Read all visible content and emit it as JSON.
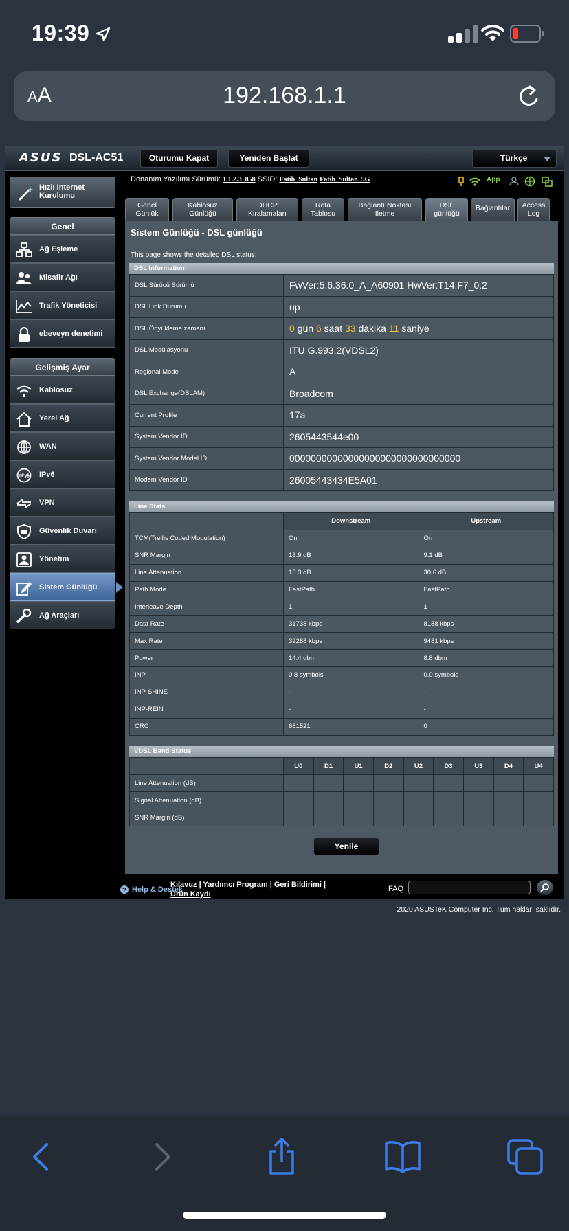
{
  "status_bar": {
    "time": "19:39"
  },
  "browser": {
    "aa_small": "A",
    "aa_large": "A",
    "url": "192.168.1.1"
  },
  "router": {
    "logo": "ASUS",
    "model": "DSL-AC51",
    "buttons": {
      "logout": "Oturumu Kapat",
      "reboot": "Yeniden Başlat"
    },
    "language": "Türkçe",
    "fw_label": "Donanım Yazılımı Sürümü:",
    "fw_version": "1.1.2.3_858",
    "ssid_label": "SSID:",
    "ssid_1": "Fatih_Sultan",
    "ssid_2": "Fatih_Sultan_5G",
    "app_label": "App"
  },
  "sidebar": {
    "quick_setup": "Hızlı Internet Kurulumu",
    "general_header": "Genel",
    "general_items": [
      "Ağ Eşleme",
      "Misafir Ağı",
      "Trafik Yöneticisi",
      "ebeveyn denetimi"
    ],
    "advanced_header": "Gelişmiş Ayar",
    "advanced_items": [
      "Kablosuz",
      "Yerel Ağ",
      "WAN",
      "IPv6",
      "VPN",
      "Güvenlik Duvarı",
      "Yönetim",
      "Sistem Günlüğü",
      "Ağ Araçları"
    ]
  },
  "tabs": [
    {
      "l1": "Genel",
      "l2": "Günlük"
    },
    {
      "l1": "Kablosuz",
      "l2": "Günlüğü"
    },
    {
      "l1": "DHCP",
      "l2": "Kiralamaları"
    },
    {
      "l1": "Rota",
      "l2": "Tablosu"
    },
    {
      "l1": "Bağlantı Noktası",
      "l2": "İletme"
    },
    {
      "l1": "DSL",
      "l2": "günlüğü"
    },
    {
      "l1": "Bağlantılar",
      "l2": ""
    },
    {
      "l1": "Access",
      "l2": "Log"
    }
  ],
  "page": {
    "title": "Sistem Günlüğü - DSL günlüğü",
    "description": "This page shows the detailed DSL status."
  },
  "dsl_info": {
    "header": "DSL Information",
    "rows": [
      {
        "label": "DSL Sürücü Sürümü",
        "value": "FwVer:5.6.36.0_A_A60901 HwVer:T14.F7_0.2"
      },
      {
        "label": "DSL Link Durumu",
        "value": "up"
      },
      {
        "label": "DSL Önyükleme zamanı",
        "value": ""
      },
      {
        "label": "DSL Modülasyonu",
        "value": "ITU G.993.2(VDSL2)"
      },
      {
        "label": "Regional Mode",
        "value": "A"
      },
      {
        "label": "DSL Exchange(DSLAM)",
        "value": "Broadcom"
      },
      {
        "label": "Current Profile",
        "value": "17a"
      },
      {
        "label": "System Vendor ID",
        "value": "2605443544e00"
      },
      {
        "label": "System Vendor Model ID",
        "value": "00000000000000000000000000000000"
      },
      {
        "label": "Modem Vendor ID",
        "value": "26005443434E5A01"
      }
    ],
    "uptime": {
      "days": "0",
      "days_unit": "gün",
      "hours": "6",
      "hours_unit": "saat",
      "minutes": "33",
      "minutes_unit": "dakika",
      "seconds": "11",
      "seconds_unit": "saniye"
    }
  },
  "line_stats": {
    "header": "Line Stats",
    "col_down": "Downstream",
    "col_up": "Upstream",
    "rows": [
      {
        "label": "TCM(Trellis Coded Modulation)",
        "down": "On",
        "up": "On"
      },
      {
        "label": "SNR Margin",
        "down": "13.9 dB",
        "up": "9.1 dB"
      },
      {
        "label": "Line Attenuation",
        "down": "15.3 dB",
        "up": "30.6 dB"
      },
      {
        "label": "Path Mode",
        "down": "FastPath",
        "up": "FastPath"
      },
      {
        "label": "Interleave Depth",
        "down": "1",
        "up": "1"
      },
      {
        "label": "Data Rate",
        "down": "31738 kbps",
        "up": "8188 kbps"
      },
      {
        "label": "Max Rate",
        "down": "39288 kbps",
        "up": "9481 kbps"
      },
      {
        "label": "Power",
        "down": "14.4 dbm",
        "up": "8.8 dbm"
      },
      {
        "label": "INP",
        "down": "0.8 symbols",
        "up": "0.0 symbols"
      },
      {
        "label": "INP-SHINE",
        "down": "-",
        "up": "-"
      },
      {
        "label": "INP-REIN",
        "down": "-",
        "up": "-"
      },
      {
        "label": "CRC",
        "down": "681521",
        "up": "0"
      }
    ]
  },
  "vdsl_band": {
    "header": "VDSL Band Status",
    "bands": [
      "U0",
      "D1",
      "U1",
      "D2",
      "U2",
      "D3",
      "U3",
      "D4",
      "U4"
    ],
    "rows": [
      "Line Attenuation (dB)",
      "Signal Attenuation (dB)",
      "SNR Margin (dB)"
    ]
  },
  "refresh_button": "Yenile",
  "footer": {
    "help": "Help & Destek",
    "link_manual": "Kılavuz",
    "link_utility": "Yardımcı Program",
    "link_feedback": "Geri Bildirimi",
    "link_register": "Ürün Kaydı",
    "sep": "|",
    "faq": "FAQ",
    "copyright": "2020 ASUSTeK Computer Inc. Tüm hakları saklıdır."
  },
  "colors": {
    "accent_yellow": "#f2c338",
    "app_green": "#7fd03a",
    "help_blue": "#8fb6e0",
    "safari_blue": "#3d7de8"
  },
  "icons": {
    "status": [
      "location-arrow-icon",
      "cell-signal-icon",
      "wifi-icon",
      "battery-low-icon"
    ],
    "browser": [
      "reload-icon"
    ],
    "toolbar": [
      "back-icon",
      "forward-icon",
      "share-icon",
      "bookmarks-icon",
      "tabs-icon"
    ]
  }
}
